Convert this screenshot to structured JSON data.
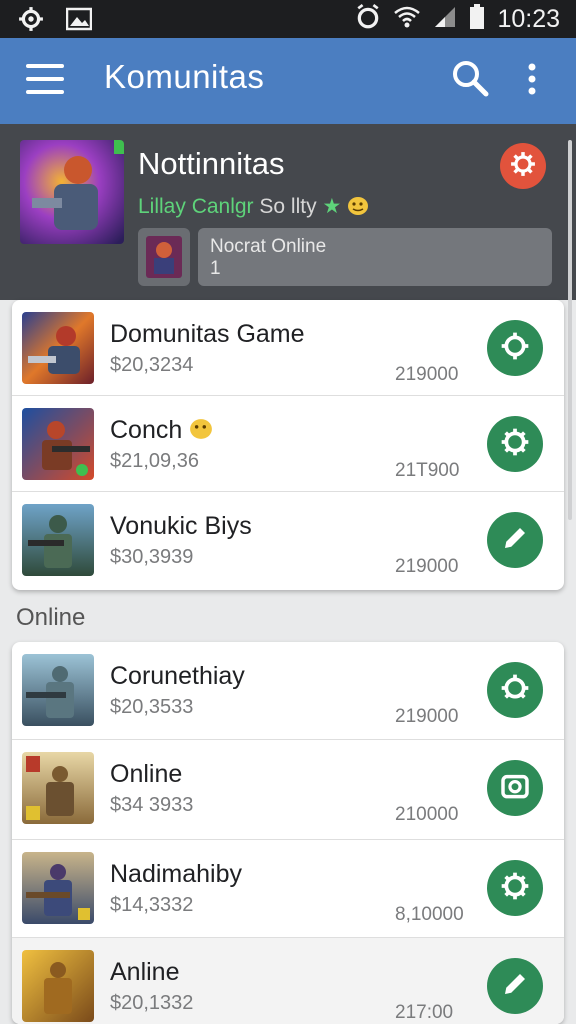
{
  "status_bar": {
    "time": "10:23",
    "left_icons": [
      "gear-icon",
      "image-icon"
    ],
    "right_icons": [
      "alarm-icon",
      "wifi-icon",
      "signal-icon",
      "battery-icon"
    ]
  },
  "app_bar": {
    "title": "Komunitas",
    "background": "#4b7ec1",
    "icons": [
      "menu-icon",
      "search-icon",
      "more-vert-icon"
    ]
  },
  "profile": {
    "name": "Nottinnitas",
    "subtitle_green": "Lillay Canlgr",
    "subtitle_rest": "So llty",
    "online_line1": "Nocrat Online",
    "online_line2": "1",
    "settings_color": "#e2533c"
  },
  "list_top": {
    "items": [
      {
        "title": "Domunitas Game",
        "price": "$20,3234",
        "count": "219000",
        "icon": "settings-icon"
      },
      {
        "title": "Conch",
        "price": "$21,09,36",
        "count": "21T900",
        "icon": "settings-icon"
      },
      {
        "title": "Vonukic Biys",
        "price": "$30,3939",
        "count": "219000",
        "icon": "edit-icon"
      }
    ]
  },
  "section_online": {
    "label": "Online",
    "items": [
      {
        "title": "Corunethiay",
        "price": "$20,3533",
        "count": "219000",
        "icon": "settings-icon"
      },
      {
        "title": "Online",
        "price": "$34 3933",
        "count": "210000",
        "icon": "camera-icon"
      },
      {
        "title": "Nadimahiby",
        "price": "$14,3332",
        "count": "8,10000",
        "icon": "settings-icon"
      },
      {
        "title": "Anline",
        "price": "$20,1332",
        "count": "217:00",
        "icon": "edit-icon"
      }
    ]
  },
  "accent_green": "#2e8b57"
}
